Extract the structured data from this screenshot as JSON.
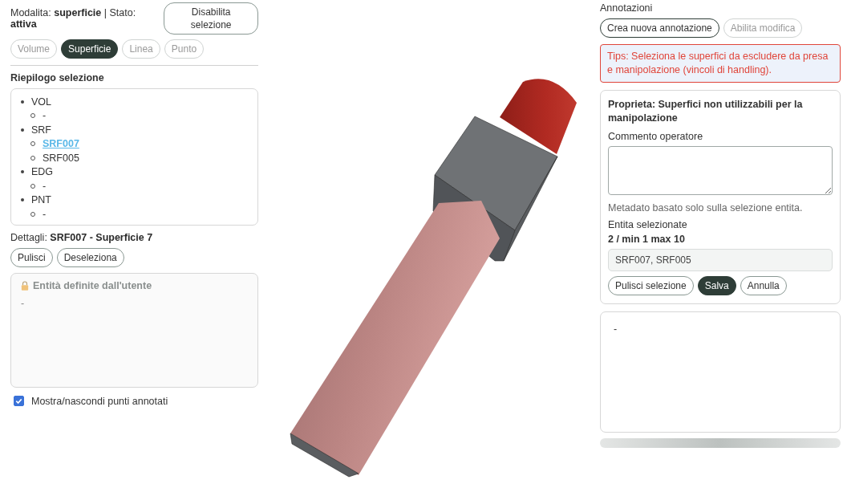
{
  "mode": {
    "label": "Modalita:",
    "value": "superficie",
    "separator": "|",
    "state_label": "Stato:",
    "state_value": "attiva"
  },
  "toggle_button": "Disabilita selezione",
  "filters": [
    {
      "label": "Volume",
      "selected": false
    },
    {
      "label": "Superficie",
      "selected": true
    },
    {
      "label": "Linea",
      "selected": false
    },
    {
      "label": "Punto",
      "selected": false
    }
  ],
  "summary": {
    "title": "Riepilogo selezione",
    "groups": [
      {
        "label": "VOL",
        "children": [
          {
            "label": "-",
            "highlighted": false
          }
        ]
      },
      {
        "label": "SRF",
        "children": [
          {
            "label": "SRF007",
            "highlighted": true
          },
          {
            "label": "SRF005",
            "highlighted": false
          }
        ]
      },
      {
        "label": "EDG",
        "children": [
          {
            "label": "-",
            "highlighted": false
          }
        ]
      },
      {
        "label": "PNT",
        "children": [
          {
            "label": "-",
            "highlighted": false
          }
        ]
      }
    ]
  },
  "details": {
    "label": "Dettagli:",
    "value": "SRF007 - Superficie 7"
  },
  "detail_buttons": [
    "Pulisci",
    "Deseleziona"
  ],
  "user_entities": {
    "title": "Entità definite dall'utente",
    "content": "-"
  },
  "show_points": {
    "label": "Mostra/nascondi punti annotati",
    "checked": true
  },
  "annotations": {
    "title": "Annotazioni",
    "buttons": [
      {
        "label": "Crea nuova annotazione",
        "disabled": false
      },
      {
        "label": "Abilita modifica",
        "disabled": true
      }
    ],
    "tip": "Tips: Seleziona le superfici da escludere da presa e manipolazione (vincoli di handling).",
    "property": {
      "title": "Proprieta: Superfici non utilizzabili per la manipolazione",
      "comment_label": "Commento operatore",
      "note": "Metadato basato solo sulla selezione entita.",
      "selected_label": "Entita selezionate",
      "count": "2 / min 1 max 10",
      "selected_value": "SRF007, SRF005",
      "actions": [
        {
          "label": "Pulisci selezione",
          "primary": false
        },
        {
          "label": "Salva",
          "primary": true
        },
        {
          "label": "Annulla",
          "primary": false
        }
      ]
    },
    "list_content": "-"
  }
}
